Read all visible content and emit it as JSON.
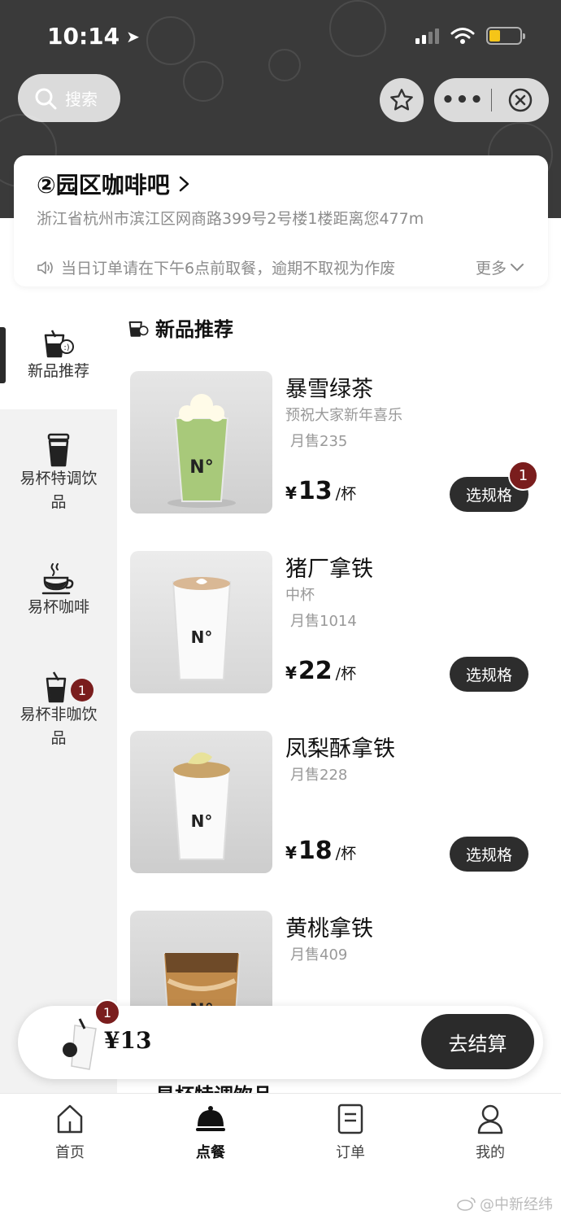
{
  "status_bar": {
    "time": "10:14"
  },
  "header": {
    "search_label": "搜索"
  },
  "store": {
    "name": "②园区咖啡吧",
    "address": "浙江省杭州市滨江区网商路399号2号楼1楼距离您477m",
    "notice": "当日订单请在下午6点前取餐，逾期不取视为作废",
    "more_label": "更多"
  },
  "sidebar": {
    "items": [
      {
        "label": "新品推荐",
        "active": true,
        "badge": ""
      },
      {
        "label": "易杯特调饮品",
        "active": false,
        "badge": ""
      },
      {
        "label": "易杯咖啡",
        "active": false,
        "badge": ""
      },
      {
        "label": "易杯非咖饮品",
        "active": false,
        "badge": "1"
      }
    ]
  },
  "section": {
    "title": "新品推荐",
    "next_title": "易杯特调饮品"
  },
  "products": [
    {
      "name": "暴雪绿茶",
      "desc": "预祝大家新年喜乐",
      "sales": "月售235",
      "currency": "¥",
      "price": "13",
      "unit": "/杯",
      "button": "选规格",
      "badge": "1"
    },
    {
      "name": "猪厂拿铁",
      "desc": "中杯",
      "sales": "月售1014",
      "currency": "¥",
      "price": "22",
      "unit": "/杯",
      "button": "选规格",
      "badge": ""
    },
    {
      "name": "凤梨酥拿铁",
      "desc": "",
      "sales": "月售228",
      "currency": "¥",
      "price": "18",
      "unit": "/杯",
      "button": "选规格",
      "badge": ""
    },
    {
      "name": "黄桃拿铁",
      "desc": "",
      "sales": "月售409",
      "currency": "",
      "price": "",
      "unit": "",
      "button": "",
      "badge": ""
    }
  ],
  "cart": {
    "badge": "1",
    "total": "¥13",
    "checkout_label": "去结算"
  },
  "tabbar": {
    "tabs": [
      {
        "label": "首页",
        "icon": "home-icon"
      },
      {
        "label": "点餐",
        "icon": "order-bell-icon"
      },
      {
        "label": "订单",
        "icon": "receipt-icon"
      },
      {
        "label": "我的",
        "icon": "profile-icon"
      }
    ]
  },
  "watermark": "@中新经纬",
  "colors": {
    "header_bg": "#3a3a3a",
    "accent_dark": "#2b2b2b",
    "badge_red": "#7a1d1d",
    "sidebar_bg": "#f2f2f2"
  }
}
